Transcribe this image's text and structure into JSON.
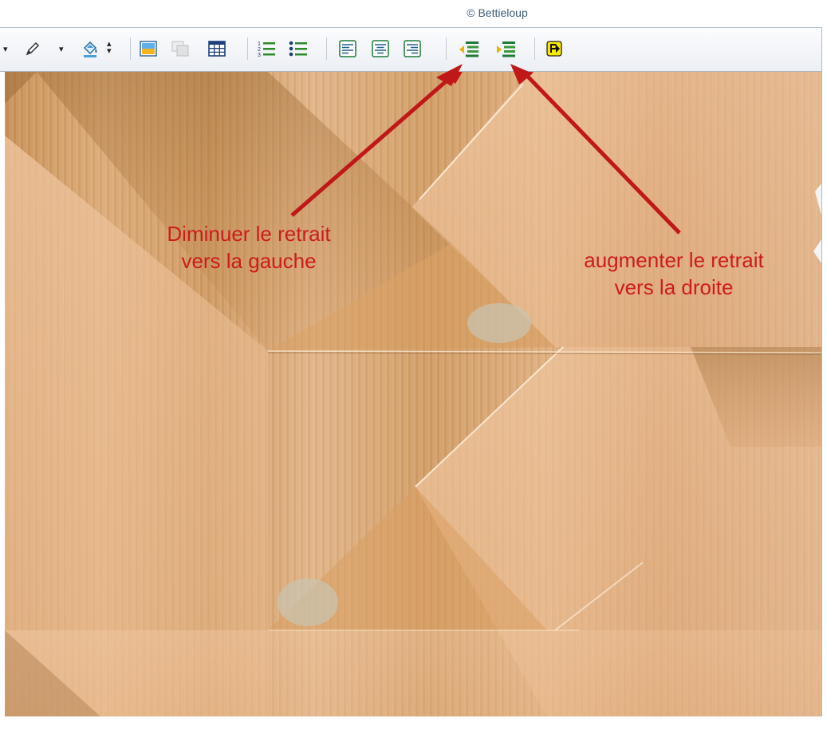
{
  "watermark": "© Bettieloup",
  "annotations": {
    "left": {
      "line1": "Diminuer le retrait",
      "line2": "vers la gauche"
    },
    "right": {
      "line1": "augmenter le retrait",
      "line2": "vers la droite"
    }
  },
  "toolbar": {
    "buttons": [
      {
        "name": "highlight-pen-button",
        "icon": "pen-icon"
      },
      {
        "name": "fill-color-button",
        "icon": "paint-bucket-icon"
      },
      {
        "name": "insert-image-button",
        "icon": "image-icon"
      },
      {
        "name": "insert-clipart-button",
        "icon": "clipart-icon"
      },
      {
        "name": "insert-table-button",
        "icon": "table-icon"
      },
      {
        "name": "numbered-list-button",
        "icon": "numbered-list-icon"
      },
      {
        "name": "bulleted-list-button",
        "icon": "bulleted-list-icon"
      },
      {
        "name": "align-left-button",
        "icon": "align-left-icon"
      },
      {
        "name": "align-center-button",
        "icon": "align-center-icon"
      },
      {
        "name": "align-right-button",
        "icon": "align-right-icon"
      },
      {
        "name": "decrease-indent-button",
        "icon": "decrease-indent-icon"
      },
      {
        "name": "increase-indent-button",
        "icon": "increase-indent-icon"
      },
      {
        "name": "insert-paragraph-button",
        "icon": "paragraph-p-icon"
      }
    ]
  },
  "colors": {
    "annotation": "#cc1c1c",
    "watermark": "#3d5a7e",
    "wood": "#d79f68"
  }
}
